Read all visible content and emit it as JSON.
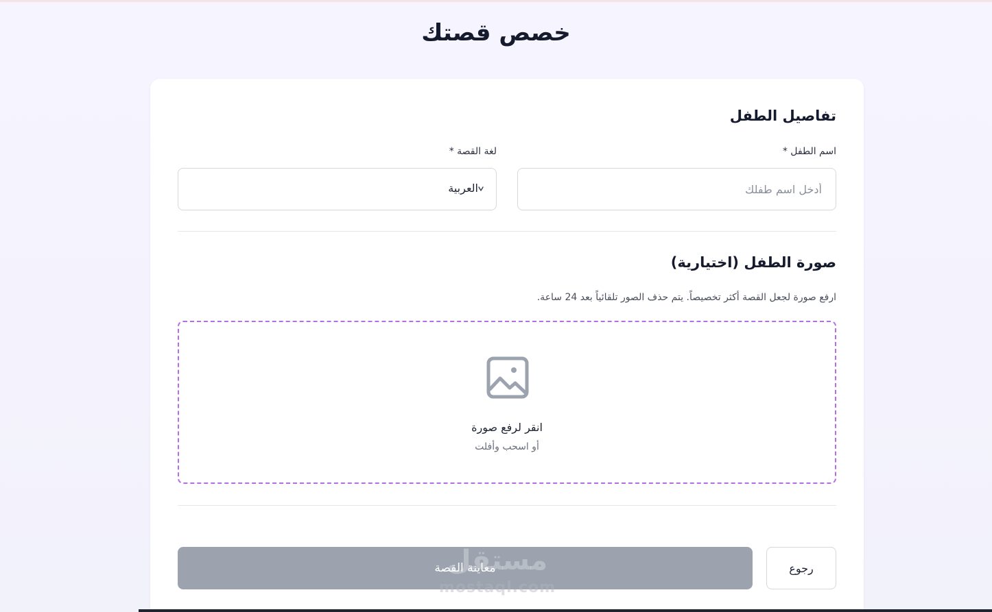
{
  "page": {
    "title": "خصص قصتك"
  },
  "child_details": {
    "heading": "تفاصيل الطفل",
    "name_label": "اسم الطفل *",
    "name_placeholder": "أدخل اسم طفلك",
    "name_value": "",
    "language_label": "لغة القصة *",
    "language_value": "العربية"
  },
  "photo": {
    "heading": "صورة الطفل (اختيارية)",
    "help": "ارفع صورة لجعل القصة أكثر تخصيصاً. يتم حذف الصور تلقائياً بعد 24 ساعة.",
    "dropzone_title": "انقر لرفع صورة",
    "dropzone_subtitle": "أو اسحب وأفلت",
    "icon": "image-icon"
  },
  "actions": {
    "preview_label": "معاينة القصة",
    "back_label": "رجوع"
  },
  "watermark": {
    "arabic": "مستقل",
    "latin": "mostaql.com"
  },
  "colors": {
    "accent_dashed_border": "#b36ee6",
    "disabled_button": "#9ca3af",
    "heading_text": "#151a2c"
  }
}
